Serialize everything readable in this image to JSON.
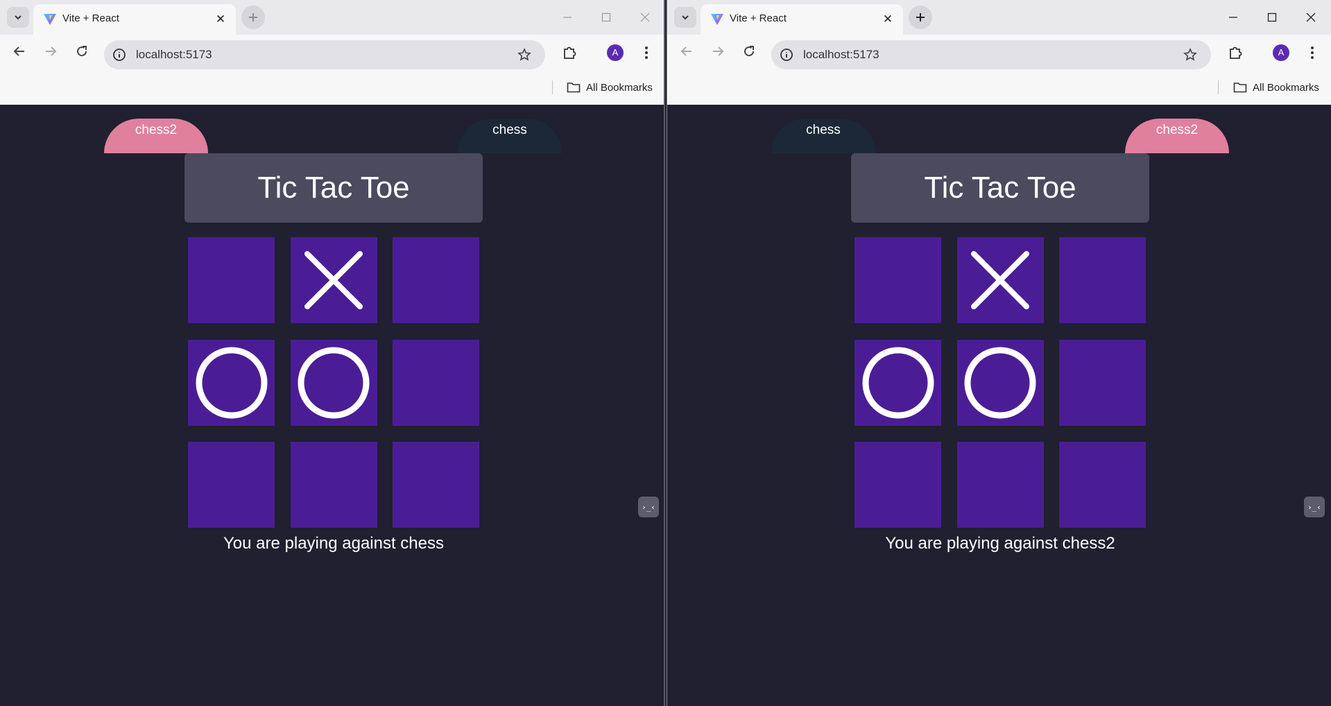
{
  "windows": [
    {
      "tab_title": "Vite + React",
      "url": "localhost:5173",
      "bookmarks_label": "All Bookmarks",
      "avatar_letter": "A",
      "active_window": false,
      "player_tabs": [
        {
          "label": "chess2",
          "color": "#e0809c",
          "active": true
        },
        {
          "label": "chess",
          "color": "#1c2838",
          "active": false
        }
      ],
      "game_title": "Tic Tac Toe",
      "board": [
        "",
        "X",
        "",
        "O",
        "O",
        "",
        "",
        "",
        ""
      ],
      "status": "You are playing against chess"
    },
    {
      "tab_title": "Vite + React",
      "url": "localhost:5173",
      "bookmarks_label": "All Bookmarks",
      "avatar_letter": "A",
      "active_window": true,
      "player_tabs": [
        {
          "label": "chess",
          "color": "#1c2838",
          "active": false
        },
        {
          "label": "chess2",
          "color": "#e0809c",
          "active": true
        }
      ],
      "game_title": "Tic Tac Toe",
      "board": [
        "",
        "X",
        "",
        "O",
        "O",
        "",
        "",
        "",
        ""
      ],
      "status": "You are playing against chess2"
    }
  ],
  "colors": {
    "page_bg": "#202030",
    "cell": "#4a1d96",
    "title_box": "#4b4a5f",
    "mark": "#ffffff"
  },
  "icons": {
    "tab_dropdown": "chevron-down-icon",
    "favicon": "vite-logo-icon",
    "close": "close-icon",
    "new_tab": "plus-icon",
    "back": "arrow-left-icon",
    "forward": "arrow-right-icon",
    "reload": "reload-icon",
    "site_info": "info-icon",
    "bookmark": "star-icon",
    "extensions": "puzzle-icon",
    "menu": "kebab-menu-icon",
    "folder": "folder-icon",
    "devtools": "devtools-widget-icon"
  }
}
